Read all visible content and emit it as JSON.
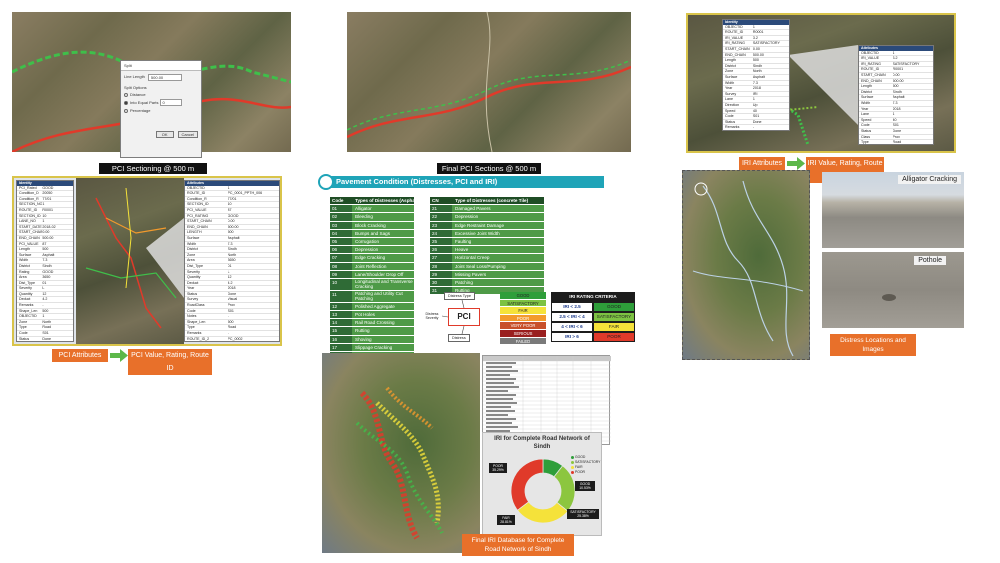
{
  "captions": {
    "pci_sectioning": "PCI Sectioning @ 500 m",
    "final_pci_sections": "Final PCI Sections @ 500 m",
    "pci_attributes": "PCI Attributes",
    "pci_value_rating": "PCI Value, Rating, Route ID",
    "iri_attributes": "IRI Attributes",
    "iri_value_rating": "IRI Value, Rating, Route ID",
    "distress_locations": "Distress Locations and Images",
    "final_iri_db": "Final IRI Database for Complete Road Network of Sindh",
    "alligator": "Alligator Cracking",
    "pothole": "Pothole"
  },
  "banner": {
    "title": "Pavement Condition (Distresses, PCI and IRI)"
  },
  "split_dialog": {
    "title": "Split",
    "line_length_label": "Line Length",
    "line_length_value": "500.00",
    "split_options": "Split Options",
    "opt_distance": "Distance",
    "opt_equal_parts": "Into Equal Parts",
    "opt_percentage": "Percentage",
    "equal_parts_value": "0",
    "ok": "OK",
    "cancel": "Cancel"
  },
  "asphalt_table": {
    "header_code": "Code",
    "header_type": "Types of Distresses (Asphalt)",
    "rows": [
      {
        "code": "01",
        "type": "Alligator"
      },
      {
        "code": "02",
        "type": "Bleeding"
      },
      {
        "code": "03",
        "type": "Block Cracking"
      },
      {
        "code": "04",
        "type": "Bumps and Sags"
      },
      {
        "code": "05",
        "type": "Corrugation"
      },
      {
        "code": "06",
        "type": "Depression"
      },
      {
        "code": "07",
        "type": "Edge Cracking"
      },
      {
        "code": "08",
        "type": "Joint Reflection"
      },
      {
        "code": "09",
        "type": "Lane/Shoulder Drop Off"
      },
      {
        "code": "10",
        "type": "Longitudinal and Transverse Cracking"
      },
      {
        "code": "11",
        "type": "Patching and Utility Cut Patching"
      },
      {
        "code": "12",
        "type": "Polished Aggregate"
      },
      {
        "code": "13",
        "type": "Pot Holes"
      },
      {
        "code": "14",
        "type": "Rail Road Crossing"
      },
      {
        "code": "15",
        "type": "Rutting"
      },
      {
        "code": "16",
        "type": "Shoving"
      },
      {
        "code": "17",
        "type": "Slippage Cracking"
      },
      {
        "code": "18",
        "type": "Swell"
      },
      {
        "code": "19",
        "type": "Weathering and Raveling"
      }
    ]
  },
  "concrete_table": {
    "header_code": "CN",
    "header_type": "Type of Distresses (concrete Tile)",
    "rows": [
      {
        "code": "21",
        "type": "Damaged Pavers"
      },
      {
        "code": "22",
        "type": "Depression"
      },
      {
        "code": "23",
        "type": "Edge Restraint Damage"
      },
      {
        "code": "24",
        "type": "Excessive Joint Width"
      },
      {
        "code": "25",
        "type": "Faulting"
      },
      {
        "code": "26",
        "type": "Heave"
      },
      {
        "code": "27",
        "type": "Horizontal Creep"
      },
      {
        "code": "28",
        "type": "Joint Seal Loss/Pumping"
      },
      {
        "code": "29",
        "type": "Missing Pavers"
      },
      {
        "code": "30",
        "type": "Patching"
      },
      {
        "code": "31",
        "type": "Rutting"
      }
    ]
  },
  "pci_diagram": {
    "center": "PCI",
    "top": "Distress Type",
    "left": "Distress Severity",
    "bottom": "Distress"
  },
  "pci_scale": [
    {
      "label": "GOOD",
      "color": "#2e9e3a"
    },
    {
      "label": "SATISFACTORY",
      "color": "#7cc242"
    },
    {
      "label": "FAIR",
      "color": "#f5e23a"
    },
    {
      "label": "POOR",
      "color": "#f39a2c"
    },
    {
      "label": "VERY POOR",
      "color": "#c8502a"
    },
    {
      "label": "SERIOUS",
      "color": "#9a1f1f"
    },
    {
      "label": "FAILED",
      "color": "#7a7a7a"
    }
  ],
  "iri_criteria": {
    "title": "IRI RATING CRITERIA",
    "rows": [
      {
        "range": "IRI < 2.5",
        "rating": "GOOD",
        "color": "#2e9e3a"
      },
      {
        "range": "2.5 < IRI < 4",
        "rating": "SATISFACTORY",
        "color": "#7cc242"
      },
      {
        "range": "4 < IRI < 6",
        "rating": "FAIR",
        "color": "#f5e23a"
      },
      {
        "range": "IRI > 6",
        "rating": "POOR",
        "color": "#e03a2a"
      }
    ]
  },
  "donut": {
    "title": "IRI for Complete Road Network of Sindh",
    "legend": [
      "GOOD",
      "SATISFACTORY",
      "FAIR",
      "POOR"
    ],
    "labels": [
      "POOR 35.29%",
      "GOOD 10.53%",
      "SATISFACTORY 25.38%",
      "FAIR 28.81%"
    ]
  },
  "chart_data": {
    "type": "pie",
    "title": "IRI for Complete Road Network of Sindh",
    "categories": [
      "GOOD",
      "SATISFACTORY",
      "FAIR",
      "POOR"
    ],
    "values": [
      10.53,
      25.38,
      28.81,
      35.29
    ],
    "colors": [
      "#2e9e3a",
      "#8cc63f",
      "#f5e23a",
      "#e03a2a"
    ],
    "legend": "top-right"
  },
  "colors": {
    "teal_banner": "#1fa4b8",
    "orange": "#e8702a",
    "green_arrow": "#5db84a"
  }
}
